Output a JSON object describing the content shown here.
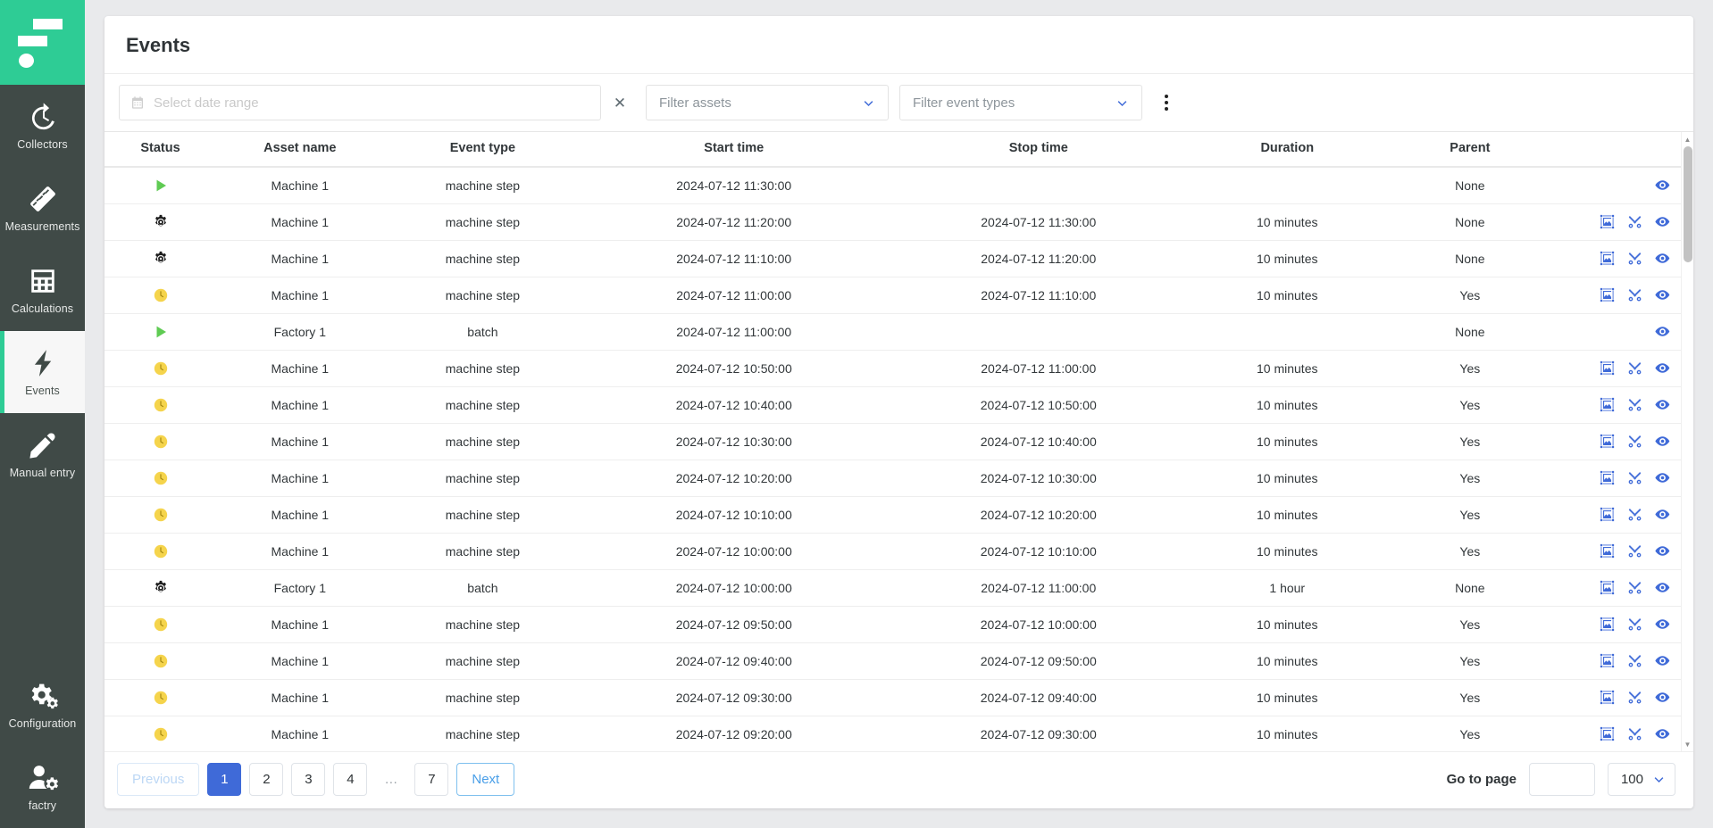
{
  "app": {
    "logo_name": "factry-logo",
    "accent_green": "#2ecc95",
    "accent_blue": "#3f6ad8",
    "sidebar_bg": "#404a47"
  },
  "sidebar": {
    "items": [
      {
        "label": "Collectors",
        "icon": "history-clock-icon",
        "active": false
      },
      {
        "label": "Measurements",
        "icon": "ruler-icon",
        "active": false
      },
      {
        "label": "Calculations",
        "icon": "calculator-icon",
        "active": false
      },
      {
        "label": "Events",
        "icon": "lightning-bolt-icon",
        "active": true
      },
      {
        "label": "Manual entry",
        "icon": "pen-icon",
        "active": false
      }
    ],
    "bottom_items": [
      {
        "label": "Configuration",
        "icon": "gears-icon"
      },
      {
        "label": "factry",
        "icon": "user-gear-icon"
      }
    ]
  },
  "header": {
    "title": "Events"
  },
  "toolbar": {
    "date_range": {
      "placeholder": "Select date range",
      "value": "",
      "icon": "calendar-icon"
    },
    "clear_label": "✕",
    "filter_assets": {
      "placeholder": "Filter assets",
      "value": "",
      "icon": "chevron-down-icon"
    },
    "filter_event_types": {
      "placeholder": "Filter event types",
      "value": "",
      "icon": "chevron-down-icon"
    },
    "more_menu_icon": "kebab-menu-icon"
  },
  "table": {
    "columns": [
      "Status",
      "Asset name",
      "Event type",
      "Start time",
      "Stop time",
      "Duration",
      "Parent",
      ""
    ],
    "rows": [
      {
        "status": "running",
        "asset": "Machine 1",
        "event_type": "machine step",
        "start": "2024-07-12 11:30:00",
        "stop": "",
        "duration": "",
        "parent": "None",
        "actions": [
          "view-icon"
        ]
      },
      {
        "status": "gear",
        "asset": "Machine 1",
        "event_type": "machine step",
        "start": "2024-07-12 11:20:00",
        "stop": "2024-07-12 11:30:00",
        "duration": "10 minutes",
        "parent": "None",
        "actions": [
          "resize-icon",
          "cut-icon",
          "view-icon"
        ]
      },
      {
        "status": "gear",
        "asset": "Machine 1",
        "event_type": "machine step",
        "start": "2024-07-12 11:10:00",
        "stop": "2024-07-12 11:20:00",
        "duration": "10 minutes",
        "parent": "None",
        "actions": [
          "resize-icon",
          "cut-icon",
          "view-icon"
        ]
      },
      {
        "status": "pending",
        "asset": "Machine 1",
        "event_type": "machine step",
        "start": "2024-07-12 11:00:00",
        "stop": "2024-07-12 11:10:00",
        "duration": "10 minutes",
        "parent": "Yes",
        "actions": [
          "resize-icon",
          "cut-icon",
          "view-icon"
        ]
      },
      {
        "status": "running",
        "asset": "Factory 1",
        "event_type": "batch",
        "start": "2024-07-12 11:00:00",
        "stop": "",
        "duration": "",
        "parent": "None",
        "actions": [
          "view-icon"
        ]
      },
      {
        "status": "pending",
        "asset": "Machine 1",
        "event_type": "machine step",
        "start": "2024-07-12 10:50:00",
        "stop": "2024-07-12 11:00:00",
        "duration": "10 minutes",
        "parent": "Yes",
        "actions": [
          "resize-icon",
          "cut-icon",
          "view-icon"
        ]
      },
      {
        "status": "pending",
        "asset": "Machine 1",
        "event_type": "machine step",
        "start": "2024-07-12 10:40:00",
        "stop": "2024-07-12 10:50:00",
        "duration": "10 minutes",
        "parent": "Yes",
        "actions": [
          "resize-icon",
          "cut-icon",
          "view-icon"
        ]
      },
      {
        "status": "pending",
        "asset": "Machine 1",
        "event_type": "machine step",
        "start": "2024-07-12 10:30:00",
        "stop": "2024-07-12 10:40:00",
        "duration": "10 minutes",
        "parent": "Yes",
        "actions": [
          "resize-icon",
          "cut-icon",
          "view-icon"
        ]
      },
      {
        "status": "pending",
        "asset": "Machine 1",
        "event_type": "machine step",
        "start": "2024-07-12 10:20:00",
        "stop": "2024-07-12 10:30:00",
        "duration": "10 minutes",
        "parent": "Yes",
        "actions": [
          "resize-icon",
          "cut-icon",
          "view-icon"
        ]
      },
      {
        "status": "pending",
        "asset": "Machine 1",
        "event_type": "machine step",
        "start": "2024-07-12 10:10:00",
        "stop": "2024-07-12 10:20:00",
        "duration": "10 minutes",
        "parent": "Yes",
        "actions": [
          "resize-icon",
          "cut-icon",
          "view-icon"
        ]
      },
      {
        "status": "pending",
        "asset": "Machine 1",
        "event_type": "machine step",
        "start": "2024-07-12 10:00:00",
        "stop": "2024-07-12 10:10:00",
        "duration": "10 minutes",
        "parent": "Yes",
        "actions": [
          "resize-icon",
          "cut-icon",
          "view-icon"
        ]
      },
      {
        "status": "gear",
        "asset": "Factory 1",
        "event_type": "batch",
        "start": "2024-07-12 10:00:00",
        "stop": "2024-07-12 11:00:00",
        "duration": "1 hour",
        "parent": "None",
        "actions": [
          "resize-icon",
          "cut-icon",
          "view-icon"
        ]
      },
      {
        "status": "pending",
        "asset": "Machine 1",
        "event_type": "machine step",
        "start": "2024-07-12 09:50:00",
        "stop": "2024-07-12 10:00:00",
        "duration": "10 minutes",
        "parent": "Yes",
        "actions": [
          "resize-icon",
          "cut-icon",
          "view-icon"
        ]
      },
      {
        "status": "pending",
        "asset": "Machine 1",
        "event_type": "machine step",
        "start": "2024-07-12 09:40:00",
        "stop": "2024-07-12 09:50:00",
        "duration": "10 minutes",
        "parent": "Yes",
        "actions": [
          "resize-icon",
          "cut-icon",
          "view-icon"
        ]
      },
      {
        "status": "pending",
        "asset": "Machine 1",
        "event_type": "machine step",
        "start": "2024-07-12 09:30:00",
        "stop": "2024-07-12 09:40:00",
        "duration": "10 minutes",
        "parent": "Yes",
        "actions": [
          "resize-icon",
          "cut-icon",
          "view-icon"
        ]
      },
      {
        "status": "pending",
        "asset": "Machine 1",
        "event_type": "machine step",
        "start": "2024-07-12 09:20:00",
        "stop": "2024-07-12 09:30:00",
        "duration": "10 minutes",
        "parent": "Yes",
        "actions": [
          "resize-icon",
          "cut-icon",
          "view-icon"
        ]
      }
    ]
  },
  "pagination": {
    "previous_label": "Previous",
    "next_label": "Next",
    "pages": [
      "1",
      "2",
      "3",
      "4",
      "…",
      "7"
    ],
    "active_page": "1",
    "goto_label": "Go to page",
    "goto_value": "",
    "per_page_value": "100",
    "per_page_icon": "chevron-down-icon"
  }
}
